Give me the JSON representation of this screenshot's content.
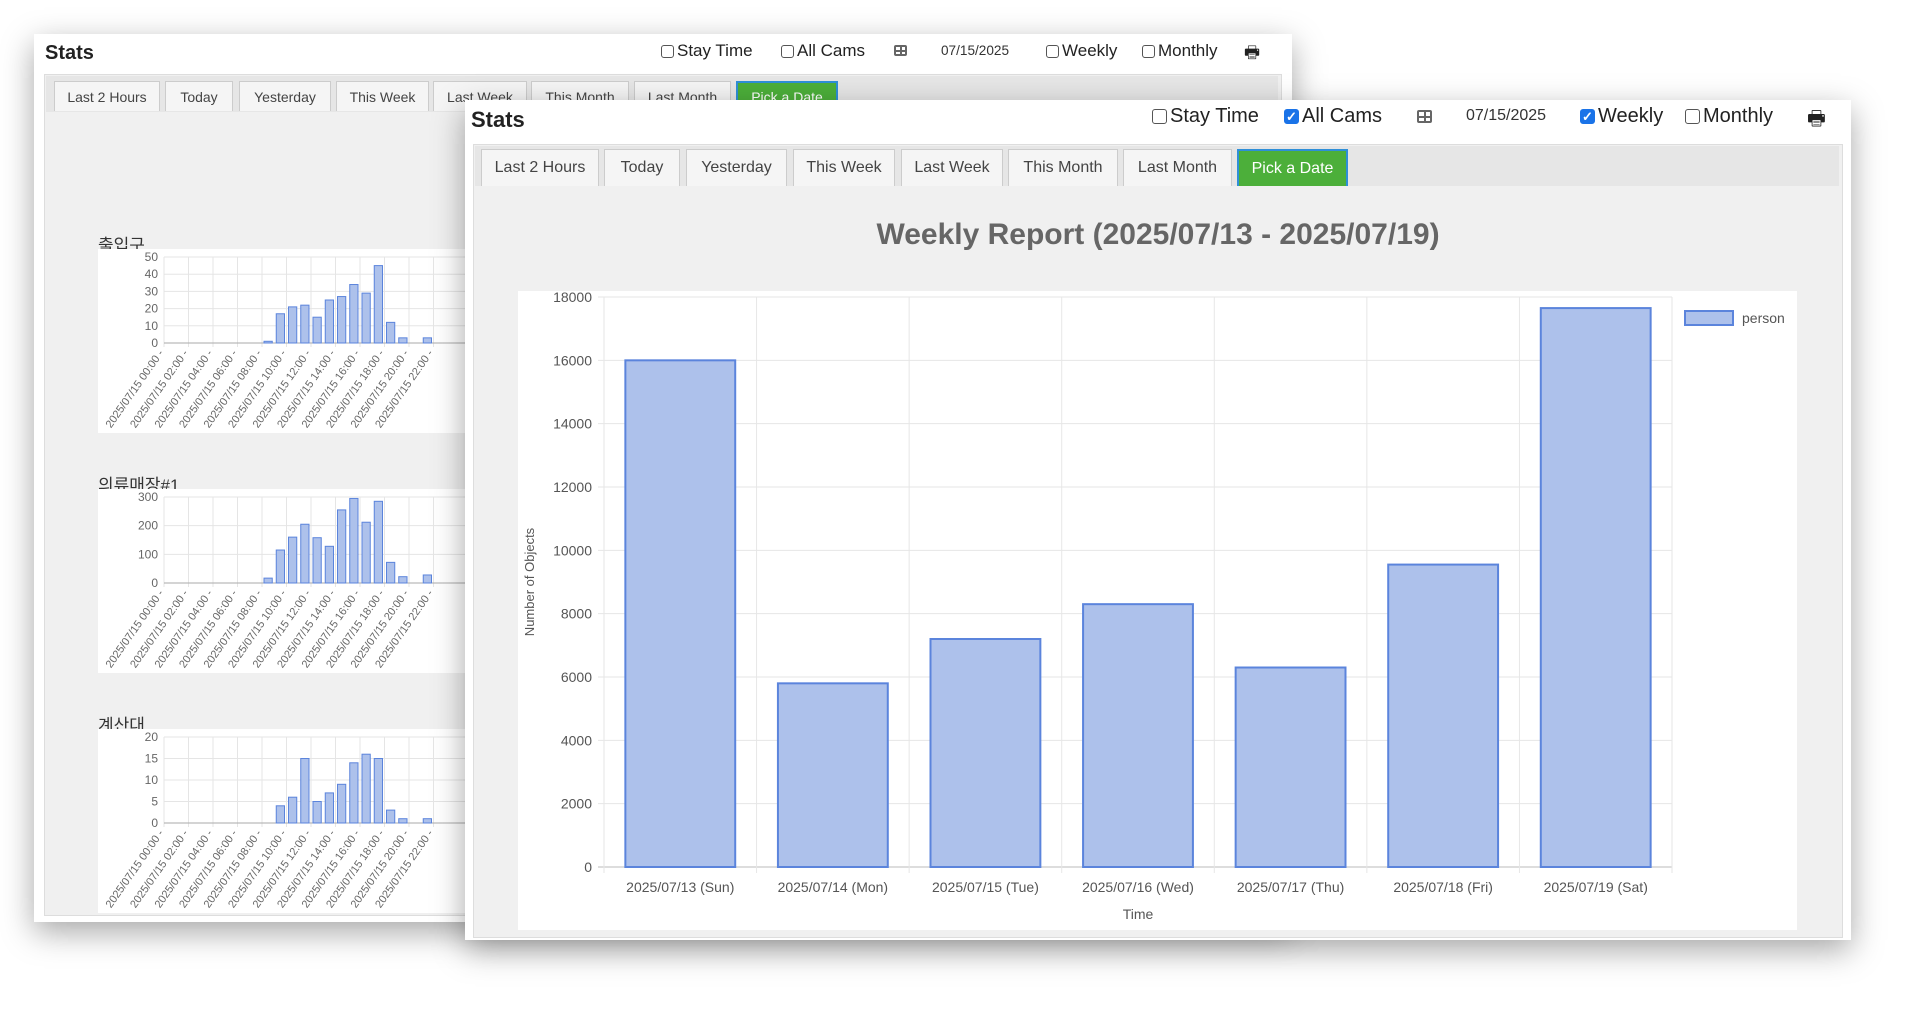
{
  "back_window": {
    "title": "Stats",
    "header": {
      "stay_time": "Stay Time",
      "stay_time_checked": false,
      "all_cams": "All Cams",
      "all_cams_checked": false,
      "date": "07/15/2025",
      "weekly": "Weekly",
      "weekly_checked": false,
      "monthly": "Monthly",
      "monthly_checked": false,
      "icons": [
        "grid-icon",
        "printer-icon"
      ]
    },
    "tabs": [
      "Last 2 Hours",
      "Today",
      "Yesterday",
      "This Week",
      "Last Week",
      "This Month",
      "Last Month",
      "Pick a Date"
    ],
    "active_tab": "Pick a Date",
    "camera_charts": [
      {
        "type": "bar",
        "title": "출입구",
        "ylim": [
          0,
          50
        ],
        "yticks": [
          0,
          10,
          20,
          30,
          40,
          50
        ],
        "xticks": [
          "2025/07/15 00:00 -",
          "2025/07/15 02:00 -",
          "2025/07/15 04:00 -",
          "2025/07/15 06:00 -",
          "2025/07/15 08:00 -",
          "2025/07/15 10:00 -",
          "2025/07/15 12:00 -",
          "2025/07/15 14:00 -",
          "2025/07/15 16:00 -",
          "2025/07/15 18:00 -",
          "2025/07/15 20:00 -",
          "2025/07/15 22:00 -"
        ],
        "values": [
          0,
          0,
          0,
          0,
          0,
          0,
          0,
          0,
          1,
          17,
          21,
          22,
          15,
          25,
          27,
          34,
          29,
          45,
          12,
          3,
          0,
          3,
          0,
          0
        ]
      },
      {
        "type": "bar",
        "title": "의류매장#1",
        "ylim": [
          0,
          300
        ],
        "yticks": [
          0,
          100,
          200,
          300
        ],
        "xticks": [
          "2025/07/15 00:00 -",
          "2025/07/15 02:00 -",
          "2025/07/15 04:00 -",
          "2025/07/15 06:00 -",
          "2025/07/15 08:00 -",
          "2025/07/15 10:00 -",
          "2025/07/15 12:00 -",
          "2025/07/15 14:00 -",
          "2025/07/15 16:00 -",
          "2025/07/15 18:00 -",
          "2025/07/15 20:00 -",
          "2025/07/15 22:00 -"
        ],
        "values": [
          0,
          0,
          0,
          0,
          0,
          0,
          0,
          0,
          17,
          115,
          160,
          205,
          158,
          128,
          255,
          295,
          212,
          285,
          72,
          22,
          0,
          28,
          0,
          0
        ]
      },
      {
        "type": "bar",
        "title": "계산대",
        "ylim": [
          0,
          20
        ],
        "yticks": [
          0,
          5,
          10,
          15,
          20
        ],
        "xticks": [
          "2025/07/15 00:00 -",
          "2025/07/15 02:00 -",
          "2025/07/15 04:00 -",
          "2025/07/15 06:00 -",
          "2025/07/15 08:00 -",
          "2025/07/15 10:00 -",
          "2025/07/15 12:00 -",
          "2025/07/15 14:00 -",
          "2025/07/15 16:00 -",
          "2025/07/15 18:00 -",
          "2025/07/15 20:00 -",
          "2025/07/15 22:00 -"
        ],
        "values": [
          0,
          0,
          0,
          0,
          0,
          0,
          0,
          0,
          0,
          4,
          6,
          15,
          5,
          7,
          9,
          14,
          16,
          15,
          3,
          1,
          0,
          1,
          0,
          0
        ]
      }
    ]
  },
  "front_window": {
    "title": "Stats",
    "header": {
      "stay_time": "Stay Time",
      "stay_time_checked": false,
      "all_cams": "All Cams",
      "all_cams_checked": true,
      "date": "07/15/2025",
      "weekly": "Weekly",
      "weekly_checked": true,
      "monthly": "Monthly",
      "monthly_checked": false,
      "icons": [
        "grid-icon",
        "printer-icon"
      ]
    },
    "tabs": [
      "Last 2 Hours",
      "Today",
      "Yesterday",
      "This Week",
      "Last Week",
      "This Month",
      "Last Month",
      "Pick a Date"
    ],
    "active_tab": "Pick a Date",
    "report_title": "Weekly Report (2025/07/13 - 2025/07/19)"
  },
  "colors": {
    "bar_fill": "#adc1eb",
    "bar_stroke": "#5b84dc",
    "active_tab": "#4caf3a"
  },
  "chart_data": {
    "type": "bar",
    "categories": [
      "2025/07/13 (Sun)",
      "2025/07/14 (Mon)",
      "2025/07/15 (Tue)",
      "2025/07/16 (Wed)",
      "2025/07/17 (Thu)",
      "2025/07/18 (Fri)",
      "2025/07/19 (Sat)"
    ],
    "series": [
      {
        "name": "person",
        "values": [
          16000,
          5800,
          7200,
          8300,
          6300,
          9550,
          17650
        ]
      }
    ],
    "xlabel": "Time",
    "ylabel": "Number of Objects",
    "ylim": [
      0,
      18000
    ],
    "yticks": [
      0,
      2000,
      4000,
      6000,
      8000,
      10000,
      12000,
      14000,
      16000,
      18000
    ],
    "grid": true,
    "legend": "top-right"
  }
}
